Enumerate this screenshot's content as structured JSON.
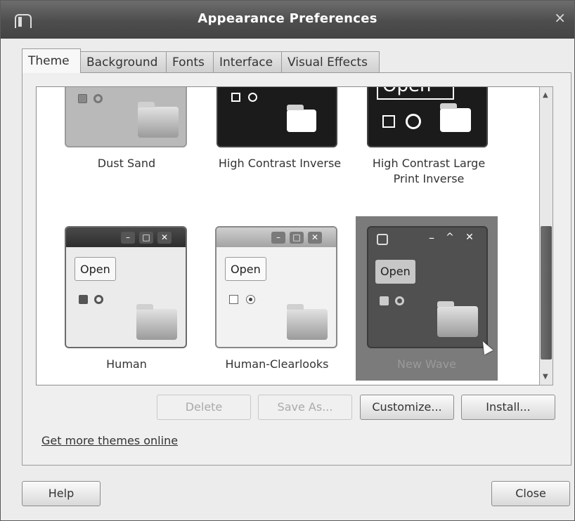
{
  "window": {
    "title": "Appearance Preferences",
    "close_glyph": "×"
  },
  "tabs": [
    {
      "label": "Theme",
      "active": true
    },
    {
      "label": "Background",
      "active": false
    },
    {
      "label": "Fonts",
      "active": false
    },
    {
      "label": "Interface",
      "active": false
    },
    {
      "label": "Visual Effects",
      "active": false
    }
  ],
  "themes": [
    {
      "name": "Dust Sand",
      "selected": false
    },
    {
      "name": "High Contrast Inverse",
      "selected": false
    },
    {
      "name": "High Contrast Large Print Inverse",
      "selected": false
    },
    {
      "name": "Human",
      "selected": false
    },
    {
      "name": "Human-Clearlooks",
      "selected": false
    },
    {
      "name": "New Wave",
      "selected": true
    }
  ],
  "theme_preview": {
    "open_label": "Open"
  },
  "actions": {
    "delete": "Delete",
    "save_as": "Save As...",
    "customize": "Customize...",
    "install": "Install..."
  },
  "link": "Get more themes online",
  "footer": {
    "help": "Help",
    "close": "Close"
  },
  "colors": {
    "titlebar": "#555555",
    "selected_theme": "#7b7b7b",
    "dark_preview": "#202020"
  }
}
